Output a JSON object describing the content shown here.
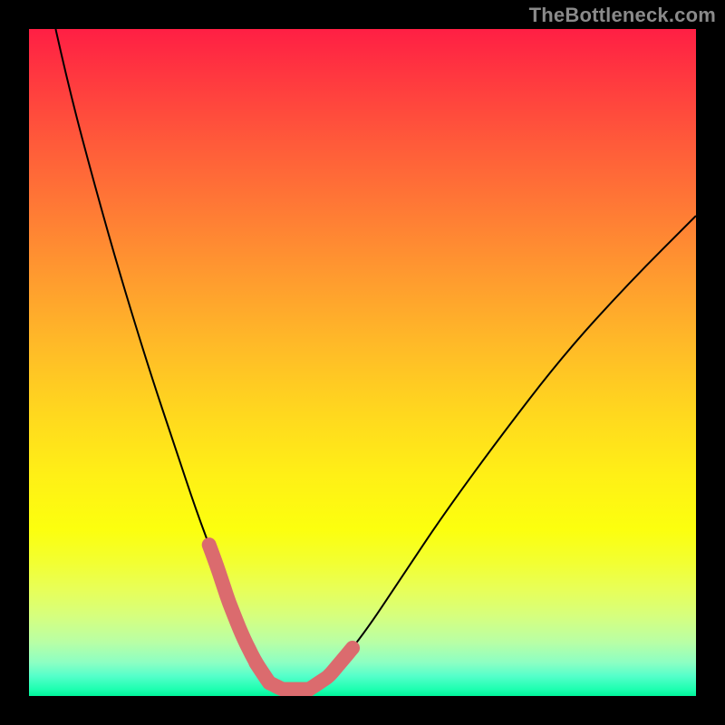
{
  "watermark": "TheBottleneck.com",
  "colors": {
    "frame_bg": "#000000",
    "curve_stroke": "#000000",
    "highlight_stroke": "#db6b6e",
    "gradient_top": "#ff1f44",
    "gradient_mid": "#fff016",
    "gradient_bottom": "#00f49a"
  },
  "chart_data": {
    "type": "line",
    "title": "",
    "xlabel": "",
    "ylabel": "",
    "xlim": [
      0,
      100
    ],
    "ylim": [
      0,
      100
    ],
    "tick_labels": {
      "x": [],
      "y": []
    },
    "grid": false,
    "legend_position": "none",
    "annotations": [
      "TheBottleneck.com"
    ],
    "series": [
      {
        "name": "bottleneck-curve",
        "x": [
          4,
          6,
          10,
          14,
          18,
          22,
          25,
          28,
          30,
          32,
          34,
          36,
          38,
          40,
          42,
          45,
          50,
          56,
          62,
          70,
          80,
          90,
          100
        ],
        "y": [
          100,
          91,
          76,
          62,
          49,
          37,
          28,
          20,
          14,
          9,
          5,
          2,
          1,
          1,
          1,
          3,
          9,
          18,
          27,
          38,
          51,
          62,
          72
        ]
      }
    ],
    "highlighted_segments": [
      {
        "name": "valley-left",
        "x_range": [
          27,
          36
        ],
        "y_approx": [
          23,
          2
        ]
      },
      {
        "name": "valley-bottom",
        "x_range": [
          34,
          42
        ],
        "y_approx": [
          1,
          1
        ]
      },
      {
        "name": "valley-right",
        "x_range": [
          42,
          48.5
        ],
        "y_approx": [
          2,
          8
        ]
      }
    ],
    "notes": "V-shaped bottleneck curve on a vertical heat gradient; minimum sits near x≈38–40 with y≈1. Values are visual estimates — axes have no tick labels."
  }
}
